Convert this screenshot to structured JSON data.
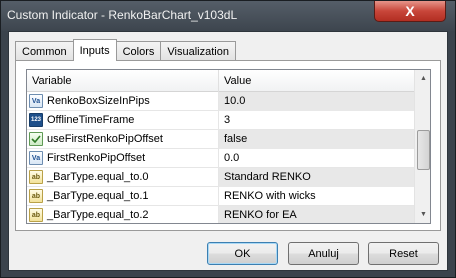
{
  "window": {
    "title": "Custom Indicator - RenkoBarChart_v103dL",
    "close_label": "X"
  },
  "tabs": [
    {
      "label": "Common"
    },
    {
      "label": "Inputs"
    },
    {
      "label": "Colors"
    },
    {
      "label": "Visualization"
    }
  ],
  "grid": {
    "headers": {
      "variable": "Variable",
      "value": "Value"
    },
    "rows": [
      {
        "name": "RenkoBoxSizeInPips",
        "value": "10.0",
        "icon": "double-type-icon",
        "icon_text": "Va"
      },
      {
        "name": "OfflineTimeFrame",
        "value": "3",
        "icon": "integer-type-icon",
        "icon_text": "123"
      },
      {
        "name": "useFirstRenkoPipOffset",
        "value": "false",
        "icon": "boolean-type-icon",
        "icon_text": ""
      },
      {
        "name": "FirstRenkoPipOffset",
        "value": "0.0",
        "icon": "double-type-icon",
        "icon_text": "Va"
      },
      {
        "name": "_BarType.equal_to.0",
        "value": "Standard RENKO",
        "icon": "string-type-icon",
        "icon_text": "ab"
      },
      {
        "name": "_BarType.equal_to.1",
        "value": "RENKO with wicks",
        "icon": "string-type-icon",
        "icon_text": "ab"
      },
      {
        "name": "_BarType.equal_to.2",
        "value": "RENKO for EA",
        "icon": "string-type-icon",
        "icon_text": "ab"
      }
    ]
  },
  "buttons": {
    "ok": "OK",
    "cancel": "Anuluj",
    "reset": "Reset"
  }
}
